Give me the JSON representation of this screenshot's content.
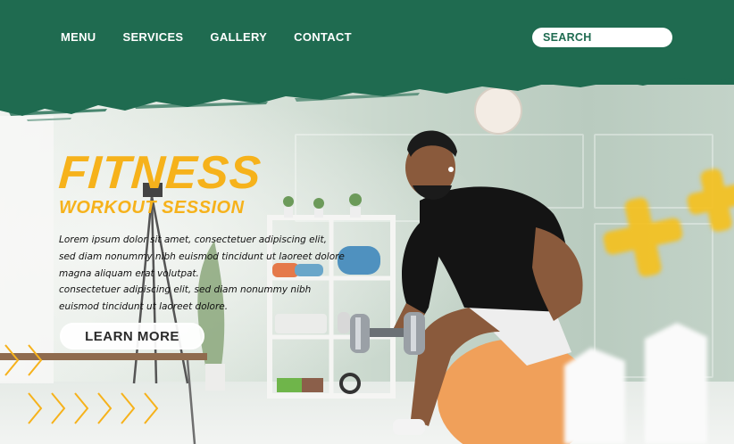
{
  "nav": {
    "items": [
      {
        "label": "MENU"
      },
      {
        "label": "SERVICES"
      },
      {
        "label": "GALLERY"
      },
      {
        "label": "CONTACT"
      }
    ]
  },
  "search": {
    "placeholder": "SEARCH"
  },
  "hero": {
    "title": "FITNESS",
    "subtitle": "WORKOUT SESSION",
    "paragraph1": "Lorem ipsum dolor sit amet, consectetuer adipiscing elit, sed diam nonummy nibh euismod tincidunt ut laoreet dolore magna aliquam erat volutpat.",
    "paragraph2": "consectetuer adipiscing elit, sed diam nonummy nibh euismod tincidunt ut laoreet dolore.",
    "cta_label": "LEARN MORE"
  },
  "colors": {
    "header_green": "#1f6b50",
    "accent_yellow": "#f6b21b",
    "text_dark": "#111111"
  },
  "icons": [
    "chevron-right-icon",
    "plus-icon"
  ]
}
